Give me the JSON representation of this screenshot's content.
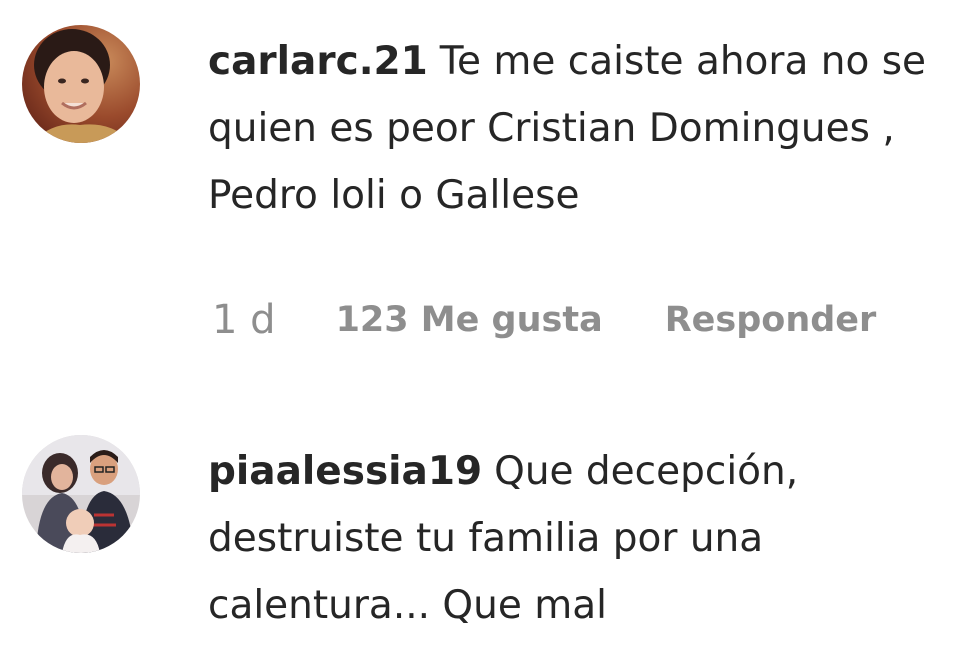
{
  "comments": [
    {
      "username": "carlarc.21",
      "text": "Te me caiste ahora no se quien es peor Cristian Domingues , Pedro loli o Gallese",
      "time": "1 d",
      "likes": "123 Me gusta",
      "reply": "Responder"
    },
    {
      "username": "piaalessia19",
      "text": "Que decepción, destruiste tu familia por una calentura... Que mal"
    }
  ],
  "colors": {
    "text": "#262626",
    "secondary": "#8e8e8e"
  }
}
